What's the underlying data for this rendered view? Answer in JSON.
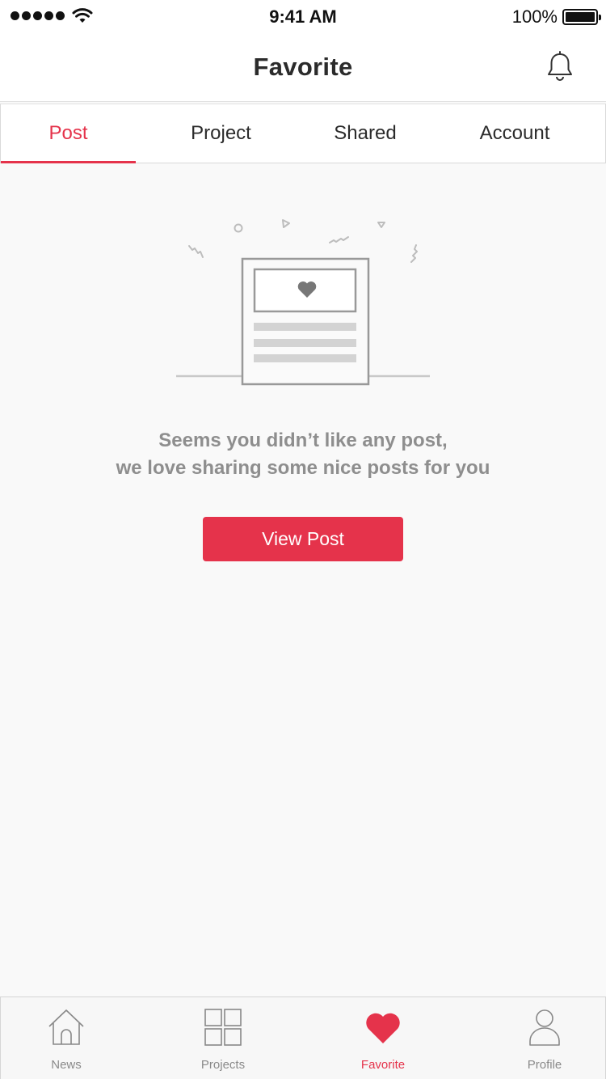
{
  "status_bar": {
    "time": "9:41 AM",
    "battery": "100%",
    "battery_level": 1.0,
    "signal_bars": 5
  },
  "header": {
    "title": "Favorite",
    "right_icon": "bell-icon"
  },
  "tabs": [
    {
      "label": "Post",
      "active": true
    },
    {
      "label": "Project",
      "active": false
    },
    {
      "label": "Shared",
      "active": false
    },
    {
      "label": "Account",
      "active": false
    }
  ],
  "empty_state": {
    "illustration_icon": "favorite-post-illustration",
    "message_line1": "Seems you didn’t like any post,",
    "message_line2": "we love sharing some nice posts for you",
    "button_label": "View Post"
  },
  "tab_bar": {
    "items": [
      {
        "label": "News",
        "icon": "home-icon",
        "active": false
      },
      {
        "label": "Projects",
        "icon": "grid-icon",
        "active": false
      },
      {
        "label": "Favorite",
        "icon": "heart-icon",
        "active": true
      },
      {
        "label": "Profile",
        "icon": "user-icon",
        "active": false
      }
    ]
  },
  "colors": {
    "accent": "#e5334b",
    "text_primary": "#2b2b2b",
    "text_muted": "#8e8e8e",
    "background": "#f9f9f9"
  }
}
